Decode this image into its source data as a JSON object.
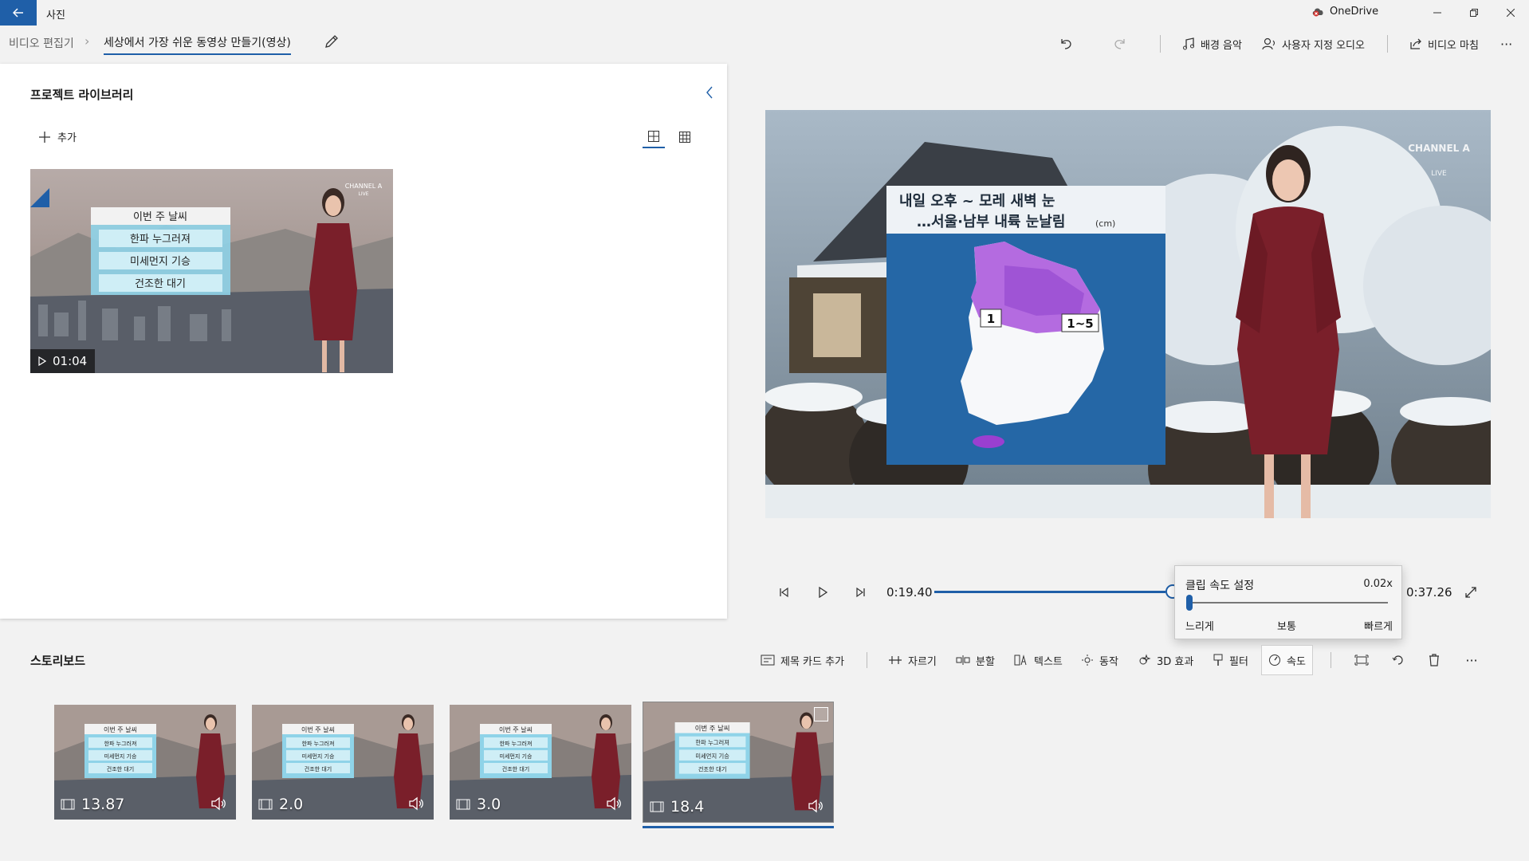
{
  "titlebar": {
    "app_title": "사진",
    "onedrive_label": "OneDrive",
    "icons": [
      "back-arrow-icon",
      "onedrive-error-icon",
      "minimize-icon",
      "restore-icon",
      "close-icon"
    ]
  },
  "cmdbar": {
    "breadcrumb_root": "비디오 편집기",
    "breadcrumb_sep": "›",
    "project_name": "세상에서 가장 쉬운 동영상 만들기(영상)",
    "background_music": "배경 음악",
    "custom_audio": "사용자 지정 오디오",
    "finish_video": "비디오 마침",
    "more": "···"
  },
  "library": {
    "title": "프로젝트 라이브러리",
    "add_label": "추가",
    "item": {
      "duration": "01:04",
      "card_title": "이번 주 날씨",
      "card_lines": [
        "한파 누그러져",
        "미세먼지 기승",
        "건조한 대기"
      ],
      "logo": "CHANNEL A",
      "logo_sub": "LIVE"
    }
  },
  "preview": {
    "headline_1": "내일 오후 ~ 모레 새벽 눈",
    "headline_2": "…서울·남부 내륙 눈날림",
    "unit": "(cm)",
    "region_a": "1",
    "region_b": "1~5",
    "logo": "CHANNEL A",
    "logo_sub": "LIVE"
  },
  "playback": {
    "current_time": "0:19.40",
    "total_time": "0:37.26",
    "progress": 0.52
  },
  "speed_popup": {
    "title": "클립 속도 설정",
    "value": "0.02x",
    "slow": "느리게",
    "normal": "보통",
    "fast": "빠르게",
    "level": 0.0
  },
  "storyboard": {
    "title": "스토리보드",
    "tools": {
      "title_card": "제목 카드 추가",
      "trim": "자르기",
      "split": "분할",
      "text": "텍스트",
      "motion": "동작",
      "effects_3d": "3D 효과",
      "filters": "필터",
      "speed": "속도",
      "more": "···"
    },
    "clips": [
      {
        "duration": "13.87"
      },
      {
        "duration": "2.0"
      },
      {
        "duration": "3.0"
      },
      {
        "duration": "18.4"
      }
    ],
    "card_title": "이번 주 날씨",
    "card_lines": [
      "한파 누그러져",
      "미세먼지 기승",
      "건조한 대기"
    ]
  },
  "colors": {
    "accent": "#1f5fa8",
    "dress": "#7a1f2a",
    "map_purple": "#b46be0",
    "snow": "#f4f6f8"
  }
}
